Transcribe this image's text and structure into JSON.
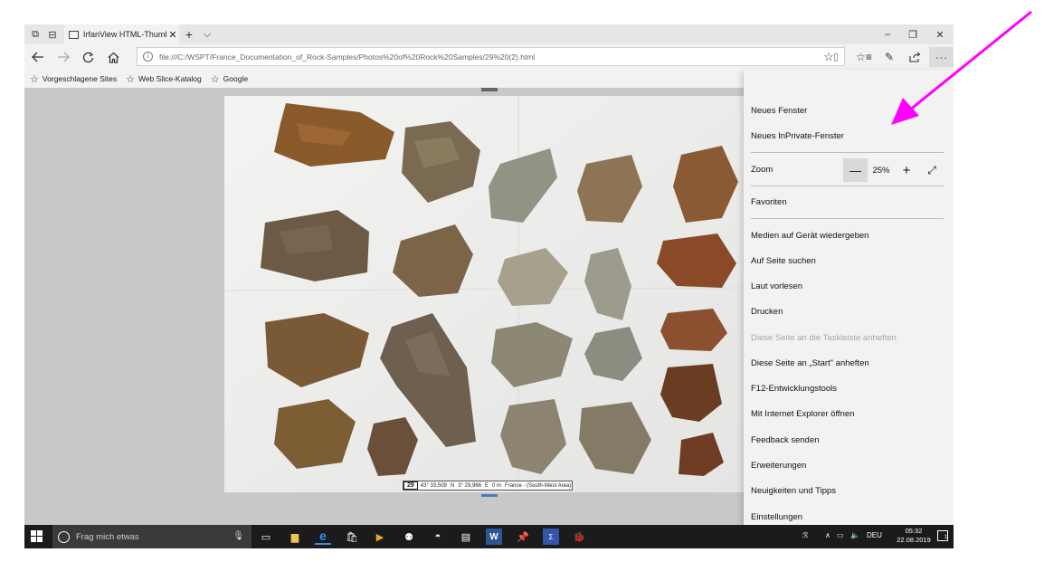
{
  "titlebar": {
    "tab_title": "IrfanView HTML-Thumb",
    "tab_close": "✕",
    "new_tab": "+",
    "tab_list": "⌵",
    "minimize": "–",
    "restore": "❐",
    "close": "✕"
  },
  "address": {
    "url": "file:///C:/WSPT/France_Documentation_of_Rock-Samples/Photos%20of%20Rock%20Samples/29%20(2).html",
    "info_glyph": "i",
    "reading_view_glyph": "▯"
  },
  "favorites_bar": {
    "items": [
      "Vorgeschlagene Sites",
      "Web Slice-Katalog",
      "Google"
    ]
  },
  "photo_caption": {
    "number": "29",
    "latitude": "43° 33,509",
    "lat_dir": "N",
    "longitude": "3° 29,966",
    "lon_dir": "E",
    "elevation": "0 m",
    "location": "France - (South-West Area)"
  },
  "menu": {
    "new_window": "Neues Fenster",
    "new_inprivate": "Neues InPrivate-Fenster",
    "zoom_label": "Zoom",
    "zoom_minus": "—",
    "zoom_value": "25%",
    "zoom_plus": "+",
    "zoom_fullscreen": "⤢",
    "favorites": "Favoriten",
    "cast_media": "Medien auf Gerät wiedergeben",
    "find_on_page": "Auf Seite suchen",
    "read_aloud": "Laut vorlesen",
    "print": "Drucken",
    "pin_taskbar": "Diese Seite an die Taskleiste anheften",
    "pin_start": "Diese Seite an „Start\" anheften",
    "devtools": "F12-Entwicklungstools",
    "open_ie": "Mit Internet Explorer öffnen",
    "feedback": "Feedback senden",
    "extensions": "Erweiterungen",
    "whats_new": "Neuigkeiten und Tipps",
    "settings": "Einstellungen"
  },
  "taskbar": {
    "search_placeholder": "Frag mich etwas",
    "language": "DEU",
    "time": "05:32",
    "date": "22.08.2019",
    "notification_count": "1"
  },
  "colors": {
    "annotation_arrow": "#ff00ff",
    "edge_accent": "#1e6fd9"
  }
}
